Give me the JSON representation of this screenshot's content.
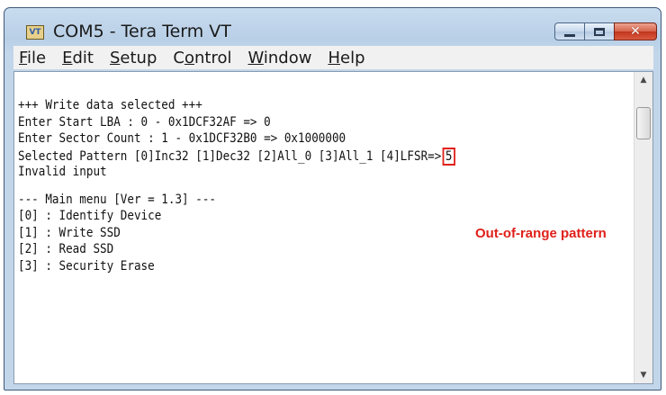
{
  "window": {
    "title": "COM5 - Tera Term VT",
    "icon_label": "VT",
    "icon": "teraterm-app-icon"
  },
  "caption_buttons": {
    "minimize": "minimize-icon",
    "maximize": "maximize-icon",
    "close": "close-icon",
    "close_glyph": "✕",
    "close_color": "#c1351d"
  },
  "menu": [
    {
      "accel": "F",
      "rest": "ile"
    },
    {
      "accel": "E",
      "rest": "dit"
    },
    {
      "accel": "S",
      "rest": "etup"
    },
    {
      "pre": "C",
      "accel": "o",
      "rest": "ntrol"
    },
    {
      "accel": "W",
      "rest": "indow"
    },
    {
      "accel": "H",
      "rest": "elp"
    }
  ],
  "terminal": {
    "lines": [
      "+++ Write data selected +++",
      "Enter Start LBA : 0 - 0x1DCF32AF => 0",
      "Enter Sector Count : 1 - 0x1DCF32B0 => 0x1000000",
      "Selected Pattern [0]Inc32 [1]Dec32 [2]All_0 [3]All_1 [4]LFSR=>",
      "Invalid input",
      "",
      "--- Main menu [Ver = 1.3] ---",
      "[0] : Identify Device",
      "[1] : Write SSD",
      "[2] : Read SSD",
      "[3] : Security Erase"
    ],
    "entered_value": "5"
  },
  "annotation": {
    "text": "Out-of-range pattern",
    "color": "#e0201a"
  },
  "scrollbar": {
    "up": "scroll-up-arrow-icon",
    "down": "scroll-down-arrow-icon",
    "up_glyph": "▲",
    "down_glyph": "▼"
  }
}
